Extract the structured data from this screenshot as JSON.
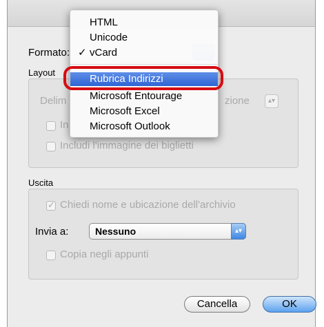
{
  "dialog": {
    "format_label": "Formato:",
    "layout_group": {
      "label": "Layout",
      "delimiter_label": "Delim",
      "delimiter_value": "zione",
      "include_partial": "In",
      "include_images": "Includi l'immagine dei biglietti"
    },
    "output_group": {
      "label": "Uscita",
      "ask_name_location": "Chiedi nome e ubicazione dell'archivio",
      "send_to_label": "Invia a:",
      "send_to_value": "Nessuno",
      "copy_clipboard": "Copia negli appunti"
    },
    "buttons": {
      "cancel": "Cancella",
      "ok": "OK"
    }
  },
  "format_menu": {
    "items": [
      {
        "label": "HTML",
        "checked": false
      },
      {
        "label": "Unicode",
        "checked": false
      },
      {
        "label": "vCard",
        "checked": true
      },
      {
        "label": "Rubrica Indirizzi",
        "checked": false,
        "selected": true
      },
      {
        "label": "Microsoft Entourage",
        "checked": false
      },
      {
        "label": "Microsoft Excel",
        "checked": false
      },
      {
        "label": "Microsoft Outlook",
        "checked": false
      }
    ],
    "check_glyph": "✓"
  },
  "colors": {
    "highlight_ring": "#d50c12",
    "selection": "#2f64d4"
  }
}
